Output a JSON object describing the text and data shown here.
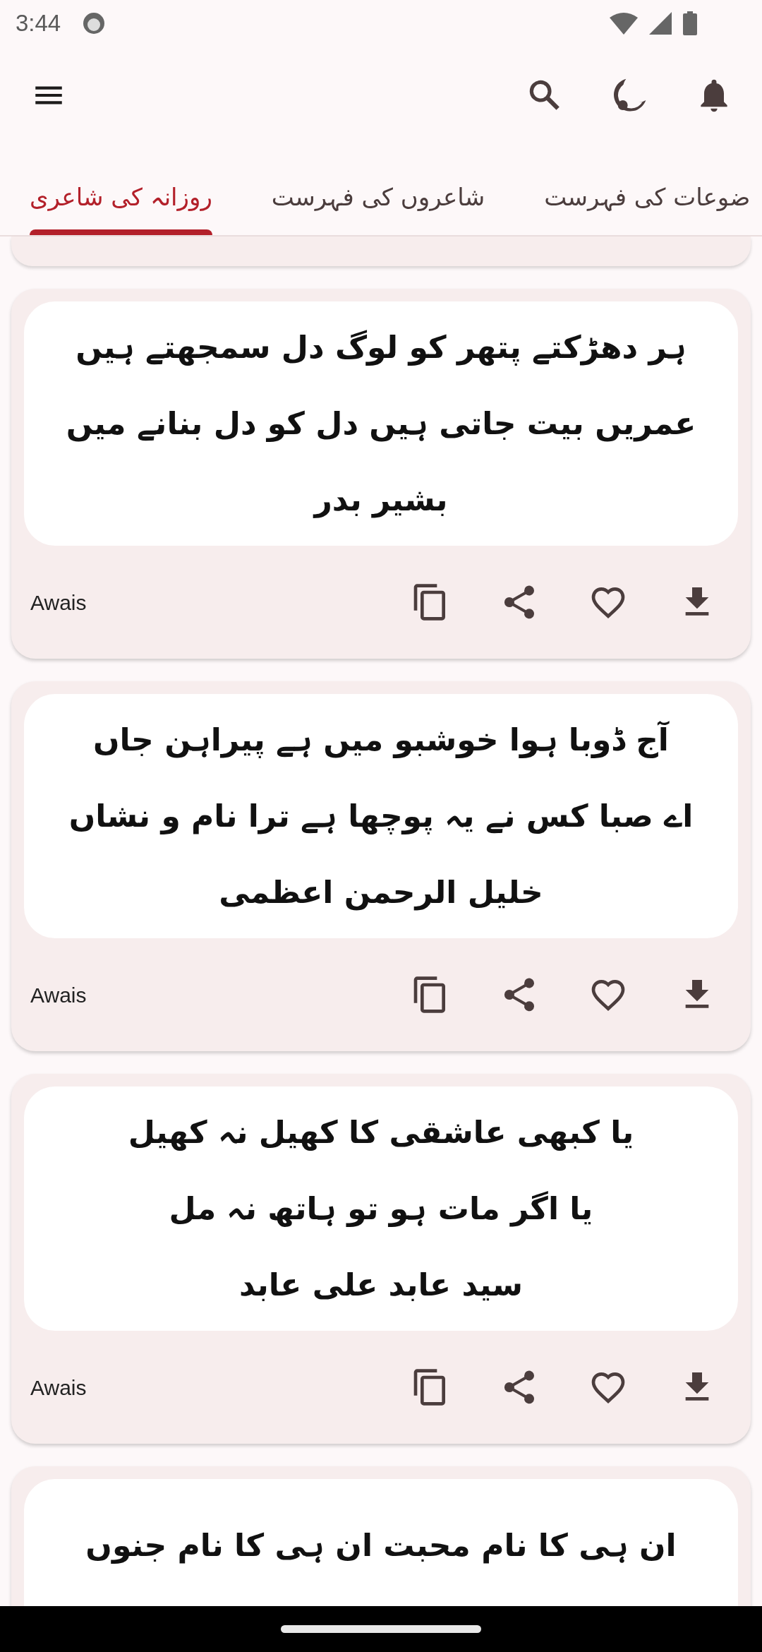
{
  "status_bar": {
    "time": "3:44"
  },
  "tabs": [
    {
      "label": "ضوعات کی فہرست",
      "selected": false
    },
    {
      "label": "شاعروں کی فہرست",
      "selected": false
    },
    {
      "label": "روزانہ کی شاعری",
      "selected": true
    }
  ],
  "cards": [
    {
      "lines": [
        "ہر دھڑکتے پتھر کو لوگ دل سمجھتے ہیں",
        "عمریں بیت جاتی ہیں دل کو دل بنانے میں",
        "بشیر بدر"
      ],
      "user": "Awais",
      "favorite": false
    },
    {
      "lines": [
        "آج ڈوبا ہوا خوشبو میں ہے پیراہن جاں",
        "اے صبا کس نے یہ پوچھا ہے ترا نام و نشاں",
        "خلیل الرحمن اعظمی"
      ],
      "user": "Awais",
      "favorite": false
    },
    {
      "lines": [
        "یا کبھی عاشقی کا کھیل نہ کھیل",
        "یا اگر مات ہو تو ہاتھ نہ مل",
        "سید عابد علی عابد"
      ],
      "user": "Awais",
      "favorite": false
    },
    {
      "lines": [
        "ان ہی کا نام محبت ان ہی کا نام جنوں"
      ]
    }
  ]
}
